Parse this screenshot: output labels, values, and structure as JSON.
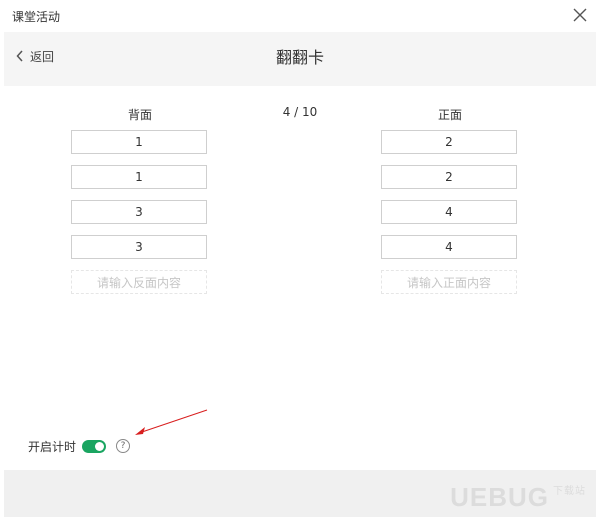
{
  "window": {
    "title": "课堂活动"
  },
  "header": {
    "back_label": "返回",
    "title": "翻翻卡"
  },
  "cards": {
    "back_title": "背面",
    "front_title": "正面",
    "counter": "4 / 10",
    "back_values": [
      "1",
      "1",
      "3",
      "3"
    ],
    "front_values": [
      "2",
      "2",
      "4",
      "4"
    ],
    "back_placeholder": "请输入反面内容",
    "front_placeholder": "请输入正面内容"
  },
  "timer": {
    "label": "开启计时",
    "enabled": true,
    "help_symbol": "?"
  },
  "watermark": {
    "text": "UEBUG",
    "sub": "下载站"
  },
  "colors": {
    "toggle_on": "#1aa561",
    "arrow": "#d81e1e"
  },
  "icons": [
    "close-icon",
    "chevron-left-icon",
    "question-icon"
  ]
}
